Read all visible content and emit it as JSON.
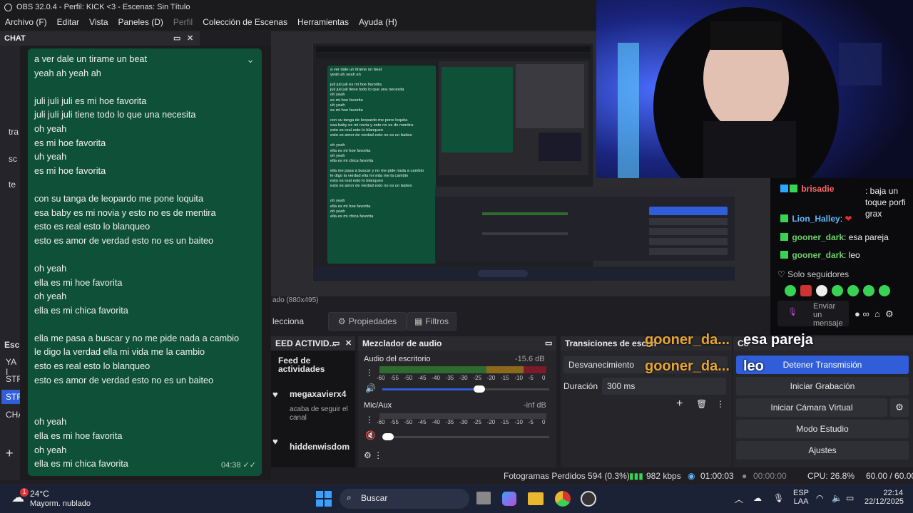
{
  "window": {
    "title": "OBS 32.0.4 - Perfil: KICK <3 - Escenas: Sin Título"
  },
  "menu": [
    "Archivo (F)",
    "Editar",
    "Vista",
    "Paneles (D)",
    "Perfil",
    "Colección de Escenas",
    "Herramientas",
    "Ayuda (H)"
  ],
  "chat_dock": {
    "title": "CHAT"
  },
  "left_col": [
    "tra",
    "sc",
    "te",
    "YA I",
    "STR",
    "STR",
    "CHA",
    "Esc",
    "S"
  ],
  "chat_bubble": {
    "lines": [
      "a ver dale un tirame un beat",
      "yeah ah yeah ah",
      "",
      "juli juli juli es mi hoe favorita",
      "juli juli juli tiene todo lo que una necesita",
      "oh yeah",
      "es mi hoe favorita",
      "uh yeah",
      "es mi hoe favorita",
      "",
      "con su tanga de leopardo me pone loquita",
      "esa baby es mi novia y esto no es de mentira",
      "esto es real esto lo blanqueo",
      "esto es amor de verdad esto no es un baiteo",
      "",
      "oh yeah",
      "ella es mi hoe favorita",
      "oh yeah",
      "ella es mi chica favorita",
      "",
      "ella me pasa a buscar y no me pide nada a cambio",
      "le digo la verdad ella mi vida me la cambio",
      "esto es real esto lo blanqueo",
      "esto es amor de verdad esto no es un baiteo",
      "",
      "",
      "oh yeah",
      "ella es mi hoe favorita",
      "oh yeah",
      "ella es mi chica favorita"
    ],
    "time": "04:38 ✓✓"
  },
  "preview": {
    "scale_label": "ado (880x495)"
  },
  "scene_tools": {
    "select": "lecciona",
    "properties": "Propiedades",
    "filters": "Filtros"
  },
  "kick_chat": {
    "messages": [
      {
        "user": "brisadie",
        "text": ": baja un toque porfi grax",
        "color": "#ff6b6b"
      },
      {
        "user": "Lion_Halley",
        "text": ":",
        "color": "#6dd16b"
      },
      {
        "user": "gooner_dark",
        "text": ": esa pareja",
        "color": "#6dd16b"
      },
      {
        "user": "gooner_dark",
        "text": ": leo",
        "color": "#6dd16b"
      }
    ],
    "followers_only": "Solo seguidores",
    "send_label": "Enviar un mensaje"
  },
  "activity": {
    "header": "EED ACTIVID...",
    "title": "Feed de actividades",
    "items": [
      {
        "name": "megaxavierx4",
        "action": "acaba de seguir el canal"
      },
      {
        "name": "hiddenwisdom",
        "action": ""
      }
    ]
  },
  "mixer": {
    "header": "Mezclador de audio",
    "channels": [
      {
        "name": "Audio del escritorio",
        "db": "-15.6 dB",
        "level": 0.58
      },
      {
        "name": "Mic/Aux",
        "db": "-inf dB",
        "level": 0
      }
    ],
    "ticks": [
      "-60",
      "-55",
      "-50",
      "-45",
      "-40",
      "-35",
      "-30",
      "-25",
      "-20",
      "-15",
      "-10",
      "-5",
      "0"
    ]
  },
  "transitions": {
    "header": "Transiciones de escen",
    "type": "Desvanecimiento",
    "duration_label": "Duración",
    "duration": "300 ms"
  },
  "controls": {
    "header": "Co",
    "buttons": [
      "Detener Transmisión",
      "Iniciar Grabación",
      "Iniciar Cámara Virtual",
      "Modo Estudio",
      "Ajustes"
    ]
  },
  "overlays": {
    "name1": "gooner_da...",
    "msg1": "esa pareja",
    "name2": "gooner_da...",
    "msg2": "leo"
  },
  "status": {
    "dropped": "Fotogramas Perdidos 594 (0.3%)",
    "kbps": "982 kbps",
    "stream_time": "01:00:03",
    "rec_time": "00:00:00",
    "cpu": "CPU: 26.8%",
    "fps": "60.00 / 60.00 FPS"
  },
  "taskbar": {
    "temp": "24°C",
    "weather": "Mayorm. nublado",
    "weather_badge": "1",
    "search": "Buscar",
    "lang1": "ESP",
    "lang2": "LAA",
    "time": "22:14",
    "date": "22/12/2025"
  },
  "colors": {
    "accent_blue": "#2f5ed8",
    "chat_green": "#0f5138",
    "kick_green": "#39d353"
  }
}
